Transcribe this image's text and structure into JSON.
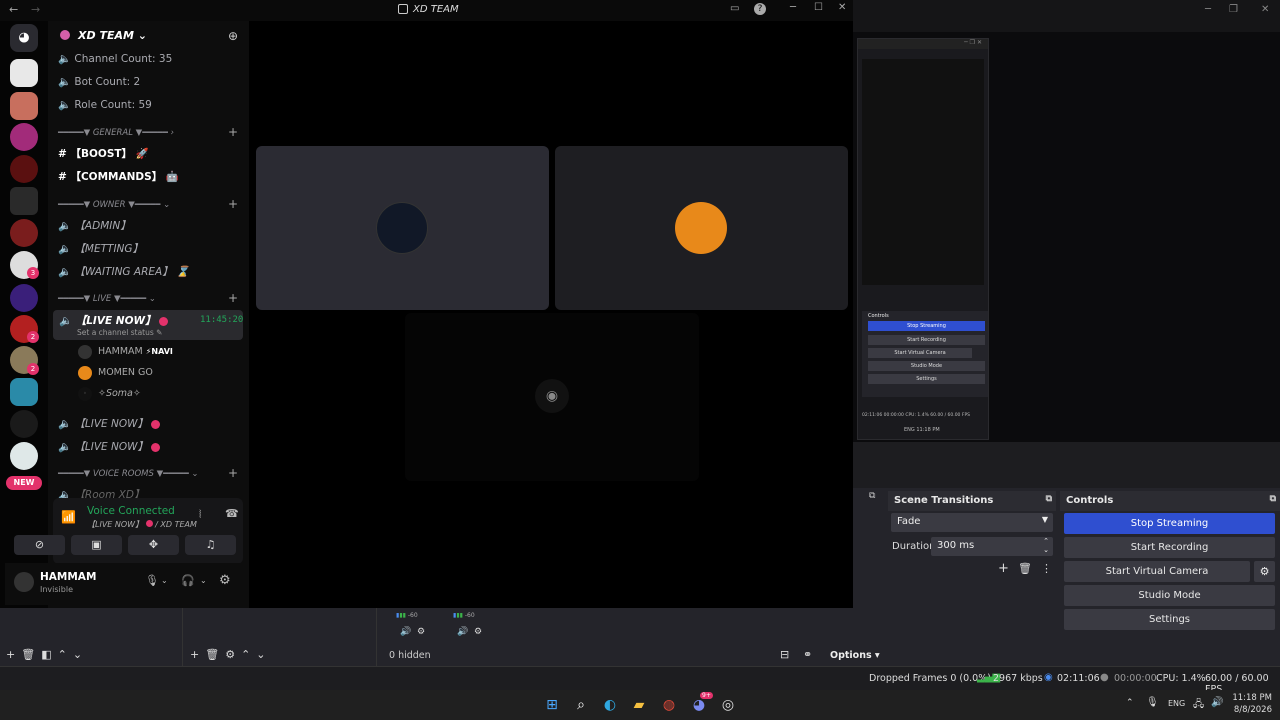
{
  "discord": {
    "window_title": "XD TEAM",
    "server_name": "XD TEAM",
    "stats": [
      "Channel Count: 35",
      "Bot Count: 2",
      "Role Count: 59"
    ],
    "categories": {
      "general": "GENERAL",
      "owner": "OWNER",
      "live": "LIVE",
      "voice_rooms": "VOICE ROOMS"
    },
    "text_channels": [
      "【BOOST】",
      "【COMMANDS】"
    ],
    "owner_channels": [
      "【ADMIN】",
      "【METTING】",
      "【WAITING AREA】"
    ],
    "live_channel": {
      "name": "【LIVE NOW】",
      "time": "11:45:20",
      "status_hint": "Set a channel status"
    },
    "voice_users": [
      {
        "name": "HAMMAM",
        "tag": "NAVI"
      },
      {
        "name": "MOMEN GO",
        "tag": ""
      },
      {
        "name": "✧Soma✧",
        "tag": ""
      }
    ],
    "extra_live_channels": [
      "【LIVE NOW】",
      "【LIVE NOW】"
    ],
    "room_partial": "【Room XD】",
    "new_badge": "NEW",
    "server_badges": [
      "3",
      "2",
      "2"
    ],
    "voice_panel": {
      "status": "Voice Connected",
      "location": "【LIVE NOW】",
      "server": "XD TEAM"
    },
    "user_panel": {
      "name": "HAMMAM",
      "status": "Invisible"
    },
    "accent_green": "#23a55a",
    "accent_pink": "#e3326b"
  },
  "obs": {
    "scene_transitions": {
      "title": "Scene Transitions",
      "selected": "Fade",
      "duration_label": "Duration",
      "duration_value": "300 ms"
    },
    "controls": {
      "title": "Controls",
      "buttons": [
        "Stop Streaming",
        "Start Recording",
        "Start Virtual Camera",
        "Studio Mode",
        "Settings"
      ]
    },
    "mini_controls": {
      "title": "Controls",
      "buttons": [
        "Stop Streaming",
        "Start Recording",
        "Start Virtual Camera",
        "Studio Mode",
        "Settings"
      ],
      "status": [
        "02:11:06",
        "00:00:00",
        "CPU: 1.4%",
        "60.00 / 60.00 FPS"
      ]
    },
    "mixer": {
      "hidden": "0 hidden",
      "options": "Options",
      "level": "-60"
    },
    "status_bar": {
      "dropped_frames": "Dropped Frames 0 (0.0%)",
      "bitrate": "2967 kbps",
      "stream_time": "02:11:06",
      "rec_time": "00:00:00",
      "cpu": "CPU: 1.4%",
      "fps": "60.00 / 60.00 FPS"
    },
    "accent_blue": "#2f4fd0"
  },
  "taskbar": {
    "lang": "ENG",
    "time": "11:18 PM",
    "date": "8/8/2026",
    "notification_badge": "9+"
  }
}
